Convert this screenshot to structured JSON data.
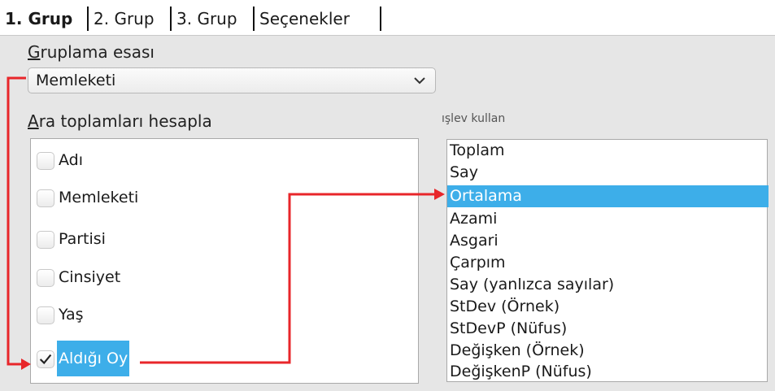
{
  "tabs": [
    "1. Grup",
    "2. Grup",
    "3. Grup",
    "Seçenekler"
  ],
  "group_by": {
    "label_underline": "G",
    "label_rest": "ruplama esası",
    "selected": "Memleketi",
    "chevron_icon": "chevron-down-icon"
  },
  "subtotals": {
    "label_underline": "A",
    "label_rest": "ra toplamları hesapla",
    "fields": [
      {
        "label": "Adı",
        "checked": false
      },
      {
        "label": "Memleketi",
        "checked": false
      },
      {
        "label": "Partisi",
        "checked": false
      },
      {
        "label": "Cinsiyet",
        "checked": false
      },
      {
        "label": "Yaş",
        "checked": false
      },
      {
        "label": "Aldığı Oy",
        "checked": true
      }
    ]
  },
  "function": {
    "label_garbled": "ışlev kullan",
    "items": [
      "Toplam",
      "Say",
      "Ortalama",
      "Azami",
      "Asgari",
      "Çarpım",
      "Say (yanlızca sayılar)",
      "StDev (Örnek)",
      "StDevP (Nüfus)",
      "Değişken (Örnek)",
      "DeğişkenP (Nüfus)"
    ],
    "selected_index": 2
  },
  "colors": {
    "selection": "#3daee9",
    "annotation_arrow": "#e8262a",
    "panel": "#e6e6e6"
  }
}
